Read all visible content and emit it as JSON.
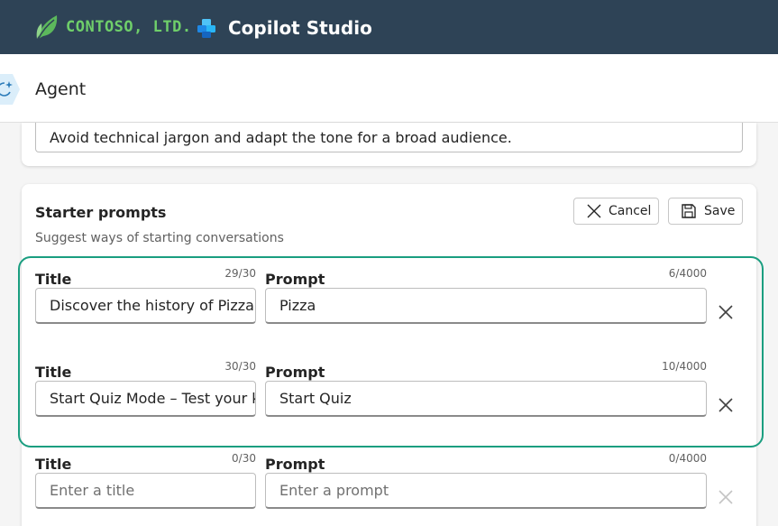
{
  "header": {
    "brand_name": "CONTOSO, LTD.",
    "product_name": "Copilot Studio",
    "background_color": "#2e4356",
    "brand_color": "#6fcf6a"
  },
  "agent_bar": {
    "title": "Agent",
    "icon": "agent-sparkle-icon"
  },
  "instructions": {
    "text": "Avoid technical jargon and adapt the tone for a broad audience."
  },
  "starter_prompts": {
    "title": "Starter prompts",
    "subtitle": "Suggest ways of starting conversations",
    "cancel_label": "Cancel",
    "save_label": "Save",
    "highlight_color": "#1a9e80",
    "rows": [
      {
        "title_label": "Title",
        "title_count": "29/30",
        "title_value": "Discover the history of Pizza",
        "prompt_label": "Prompt",
        "prompt_count": "6/4000",
        "prompt_value": "Pizza"
      },
      {
        "title_label": "Title",
        "title_count": "30/30",
        "title_value": "Start Quiz Mode – Test your knowledge",
        "prompt_label": "Prompt",
        "prompt_count": "10/4000",
        "prompt_value": "Start Quiz"
      },
      {
        "title_label": "Title",
        "title_count": "0/30",
        "title_placeholder": "Enter a title",
        "prompt_label": "Prompt",
        "prompt_count": "0/4000",
        "prompt_placeholder": "Enter a prompt"
      }
    ]
  }
}
